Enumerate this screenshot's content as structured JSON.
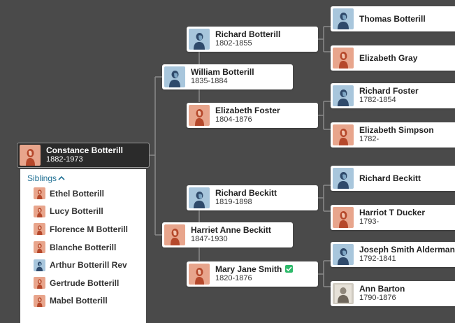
{
  "root": {
    "name": "Constance Botterill",
    "dates": "1882-1973",
    "gender": "female"
  },
  "siblings": {
    "header": "Siblings",
    "items": [
      {
        "name": "Ethel Botterill",
        "gender": "female"
      },
      {
        "name": "Lucy Botterill",
        "gender": "female"
      },
      {
        "name": "Florence M Botterill",
        "gender": "female"
      },
      {
        "name": "Blanche Botterill",
        "gender": "female"
      },
      {
        "name": "Arthur Botterill Rev",
        "gender": "male"
      },
      {
        "name": "Gertrude Botterill",
        "gender": "female"
      },
      {
        "name": "Mabel Botterill",
        "gender": "female"
      }
    ]
  },
  "parents": {
    "father": {
      "name": "William Botterill",
      "dates": "1835-1884",
      "gender": "male"
    },
    "mother": {
      "name": "Harriet Anne Beckitt",
      "dates": "1847-1930",
      "gender": "female"
    }
  },
  "grandparents": {
    "paternal_father": {
      "name": "Richard Botterill",
      "dates": "1802-1855",
      "gender": "male"
    },
    "paternal_mother": {
      "name": "Elizabeth Foster",
      "dates": "1804-1876",
      "gender": "female"
    },
    "maternal_father": {
      "name": "Richard Beckitt",
      "dates": "1819-1898",
      "gender": "male"
    },
    "maternal_mother": {
      "name": "Mary Jane Smith",
      "dates": "1820-1876",
      "gender": "female",
      "verified": true
    }
  },
  "great_grandparents": {
    "g1": {
      "name": "Thomas Botterill",
      "dates": "",
      "gender": "male"
    },
    "g2": {
      "name": "Elizabeth Gray",
      "dates": "",
      "gender": "female"
    },
    "g3": {
      "name": "Richard Foster",
      "dates": "1782-1854",
      "gender": "male"
    },
    "g4": {
      "name": "Elizabeth Simpson",
      "dates": "1782-",
      "gender": "female"
    },
    "g5": {
      "name": "Richard Beckitt",
      "dates": "",
      "gender": "male"
    },
    "g6": {
      "name": "Harriot T Ducker",
      "dates": "1793-",
      "gender": "female"
    },
    "g7": {
      "name": "Joseph Smith Alderman",
      "dates": "1792-1841",
      "gender": "male"
    },
    "g8": {
      "name": "Ann Barton",
      "dates": "1790-1876",
      "gender": "photo"
    }
  },
  "colors": {
    "background": "#4a4a4a",
    "female_avatar_bg": "#e8a58c",
    "female_figure": "#b5482b",
    "male_avatar_bg": "#a8c6dc",
    "male_figure": "#2f4a6b",
    "verified_badge": "#2db96a",
    "siblings_link": "#1f6f93"
  }
}
